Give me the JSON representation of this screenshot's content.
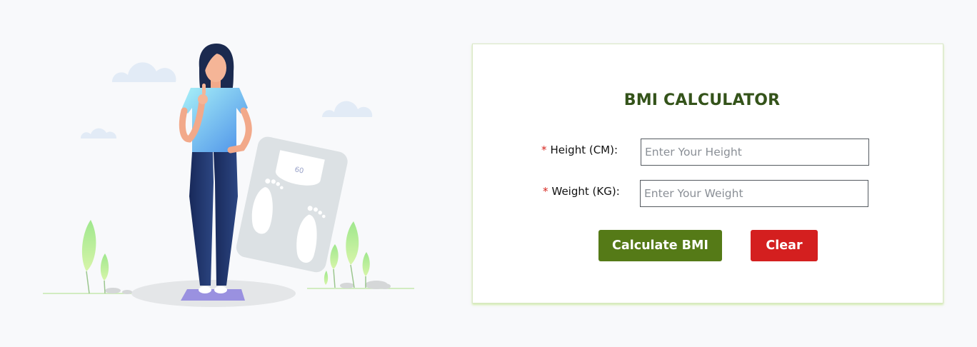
{
  "form": {
    "title": "BMI CALCULATOR",
    "required_mark": "*",
    "height": {
      "label": "Height (CM):",
      "placeholder": "Enter Your Height",
      "value": ""
    },
    "weight": {
      "label": "Weight (KG):",
      "placeholder": "Enter Your Weight",
      "value": ""
    },
    "buttons": {
      "calculate": "Calculate BMI",
      "clear": "Clear"
    }
  },
  "illustration": {
    "scale_dial_reading": "60"
  },
  "colors": {
    "page_background": "#f8f9fb",
    "title": "#34531a",
    "calculate_button": "#557a17",
    "clear_button": "#d41f1f",
    "required_mark": "#d6261f",
    "card_glow": "#b4e26e"
  }
}
